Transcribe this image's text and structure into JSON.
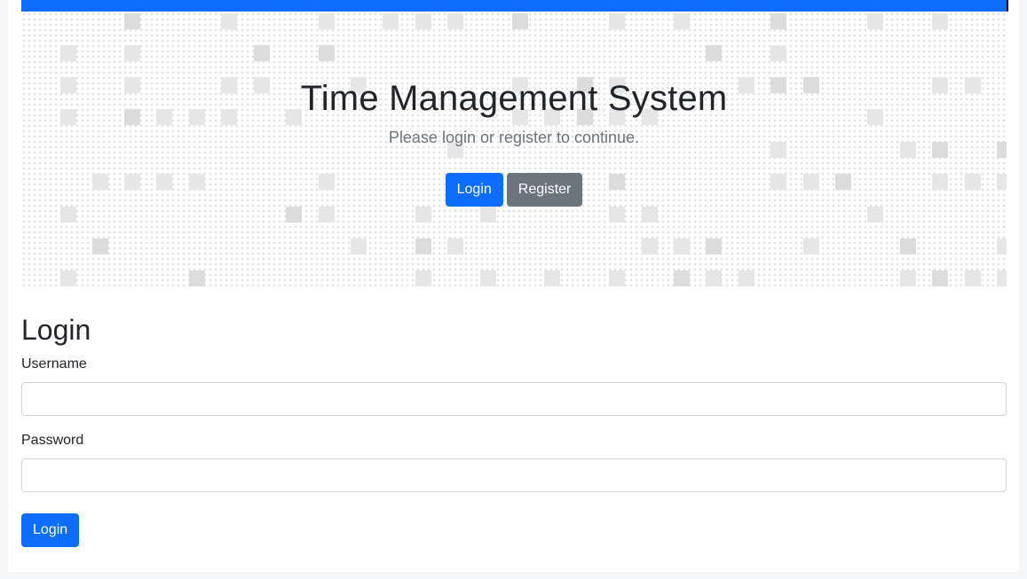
{
  "hero": {
    "title": "Time Management System",
    "subtitle": "Please login or register to continue.",
    "login_label": "Login",
    "register_label": "Register"
  },
  "form": {
    "title": "Login",
    "username_label": "Username",
    "username_value": "",
    "password_label": "Password",
    "password_value": "",
    "submit_label": "Login"
  },
  "colors": {
    "primary": "#0d6efd",
    "secondary": "#6c757d",
    "text": "#212529",
    "muted": "#6c757d"
  }
}
